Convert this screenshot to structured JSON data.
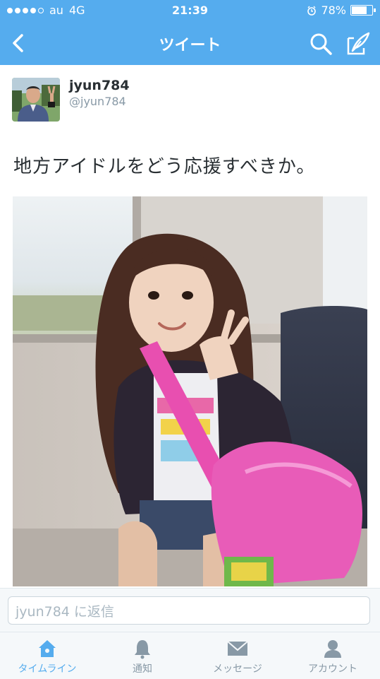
{
  "status_bar": {
    "carrier": "au",
    "network": "4G",
    "time": "21:39",
    "battery": "78%",
    "battery_level": 0.78
  },
  "nav": {
    "title": "ツイート",
    "back_icon": "chevron-left-icon",
    "search_icon": "search-icon",
    "compose_icon": "compose-icon"
  },
  "tweet": {
    "name": "jyun784",
    "handle": "@jyun784",
    "text": "地方アイドルをどう応援すべきか。"
  },
  "reply": {
    "placeholder": "jyun784 に返信"
  },
  "tabs": [
    {
      "label": "タイムライン",
      "icon": "home-icon",
      "active": true
    },
    {
      "label": "通知",
      "icon": "bell-icon",
      "active": false
    },
    {
      "label": "メッセージ",
      "icon": "envelope-icon",
      "active": false
    },
    {
      "label": "アカウント",
      "icon": "person-icon",
      "active": false
    }
  ],
  "colors": {
    "accent": "#55acee",
    "text": "#292f33",
    "muted": "#8899a6"
  }
}
